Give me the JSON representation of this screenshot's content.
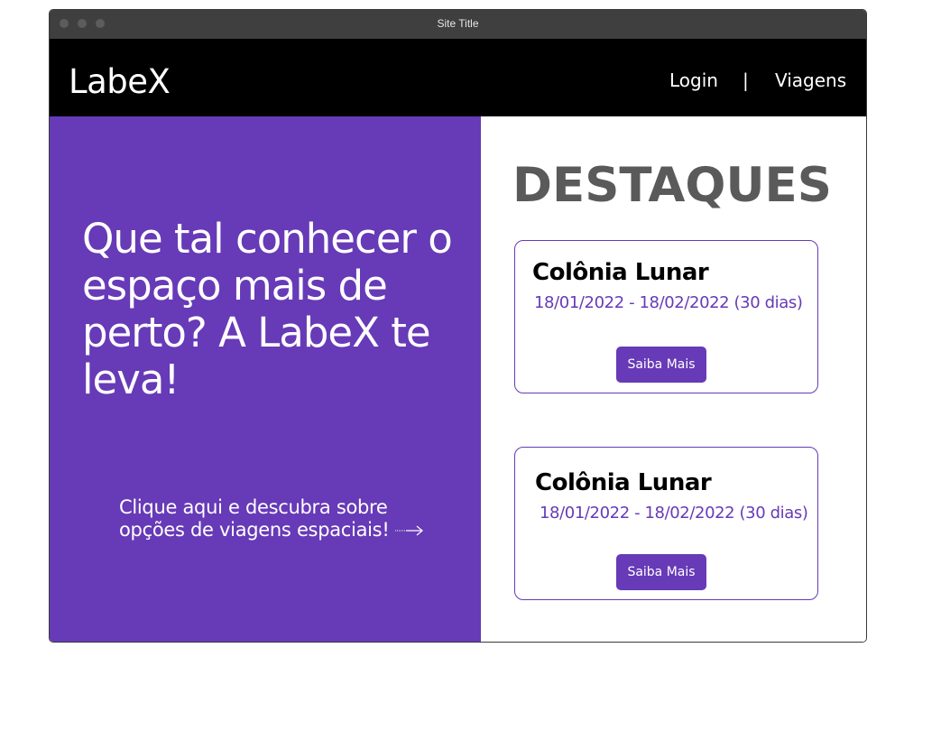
{
  "window": {
    "title": "Site Title"
  },
  "navbar": {
    "logo": "LabeX",
    "links": [
      {
        "label": "Login"
      },
      {
        "label": "Viagens"
      }
    ],
    "separator": "|"
  },
  "hero": {
    "title": "Que tal conhecer o espaço mais de perto?  A LabeX te leva!",
    "cta": "Clique aqui e descubra sobre opções de viagens espaciais!"
  },
  "highlights": {
    "title": "DESTAQUES",
    "cards": [
      {
        "title": "Colônia Lunar",
        "dates": "18/01/2022 - 18/02/2022 (30 dias)",
        "button": "Saiba Mais"
      },
      {
        "title": "Colônia Lunar",
        "dates": "18/01/2022 - 18/02/2022 (30 dias)",
        "button": "Saiba Mais"
      }
    ]
  },
  "colors": {
    "accent": "#673ab7",
    "navbar": "#000000",
    "titlebar": "#3f3f3f",
    "heading": "#5a5a5a"
  },
  "icons": {
    "cta_arrow": "arrow-right-icon"
  }
}
